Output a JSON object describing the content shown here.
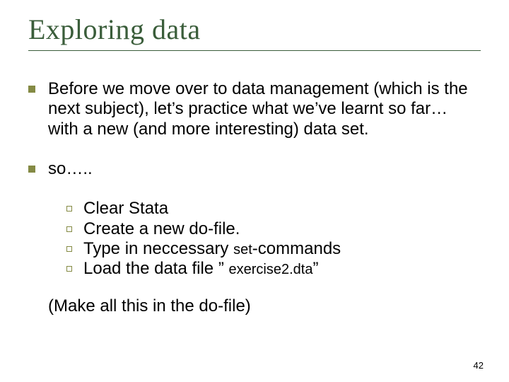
{
  "title": "Exploring data",
  "bullets": [
    {
      "text": "Before we move over to data management (which is the next subject), let’s practice what we’ve learnt so far… with a new (and more interesting) data set."
    },
    {
      "text": "so….."
    }
  ],
  "subbullets": [
    {
      "text": "Clear Stata"
    },
    {
      "text": "Create a new do-file."
    },
    {
      "pre": "Type in neccessary ",
      "cmd": "set",
      "post": "-commands"
    },
    {
      "pre": "Load the data file ” ",
      "file": "exercise2.dta",
      "post": "”"
    }
  ],
  "note": "(Make all this in the do-file)",
  "pagenum": "42"
}
